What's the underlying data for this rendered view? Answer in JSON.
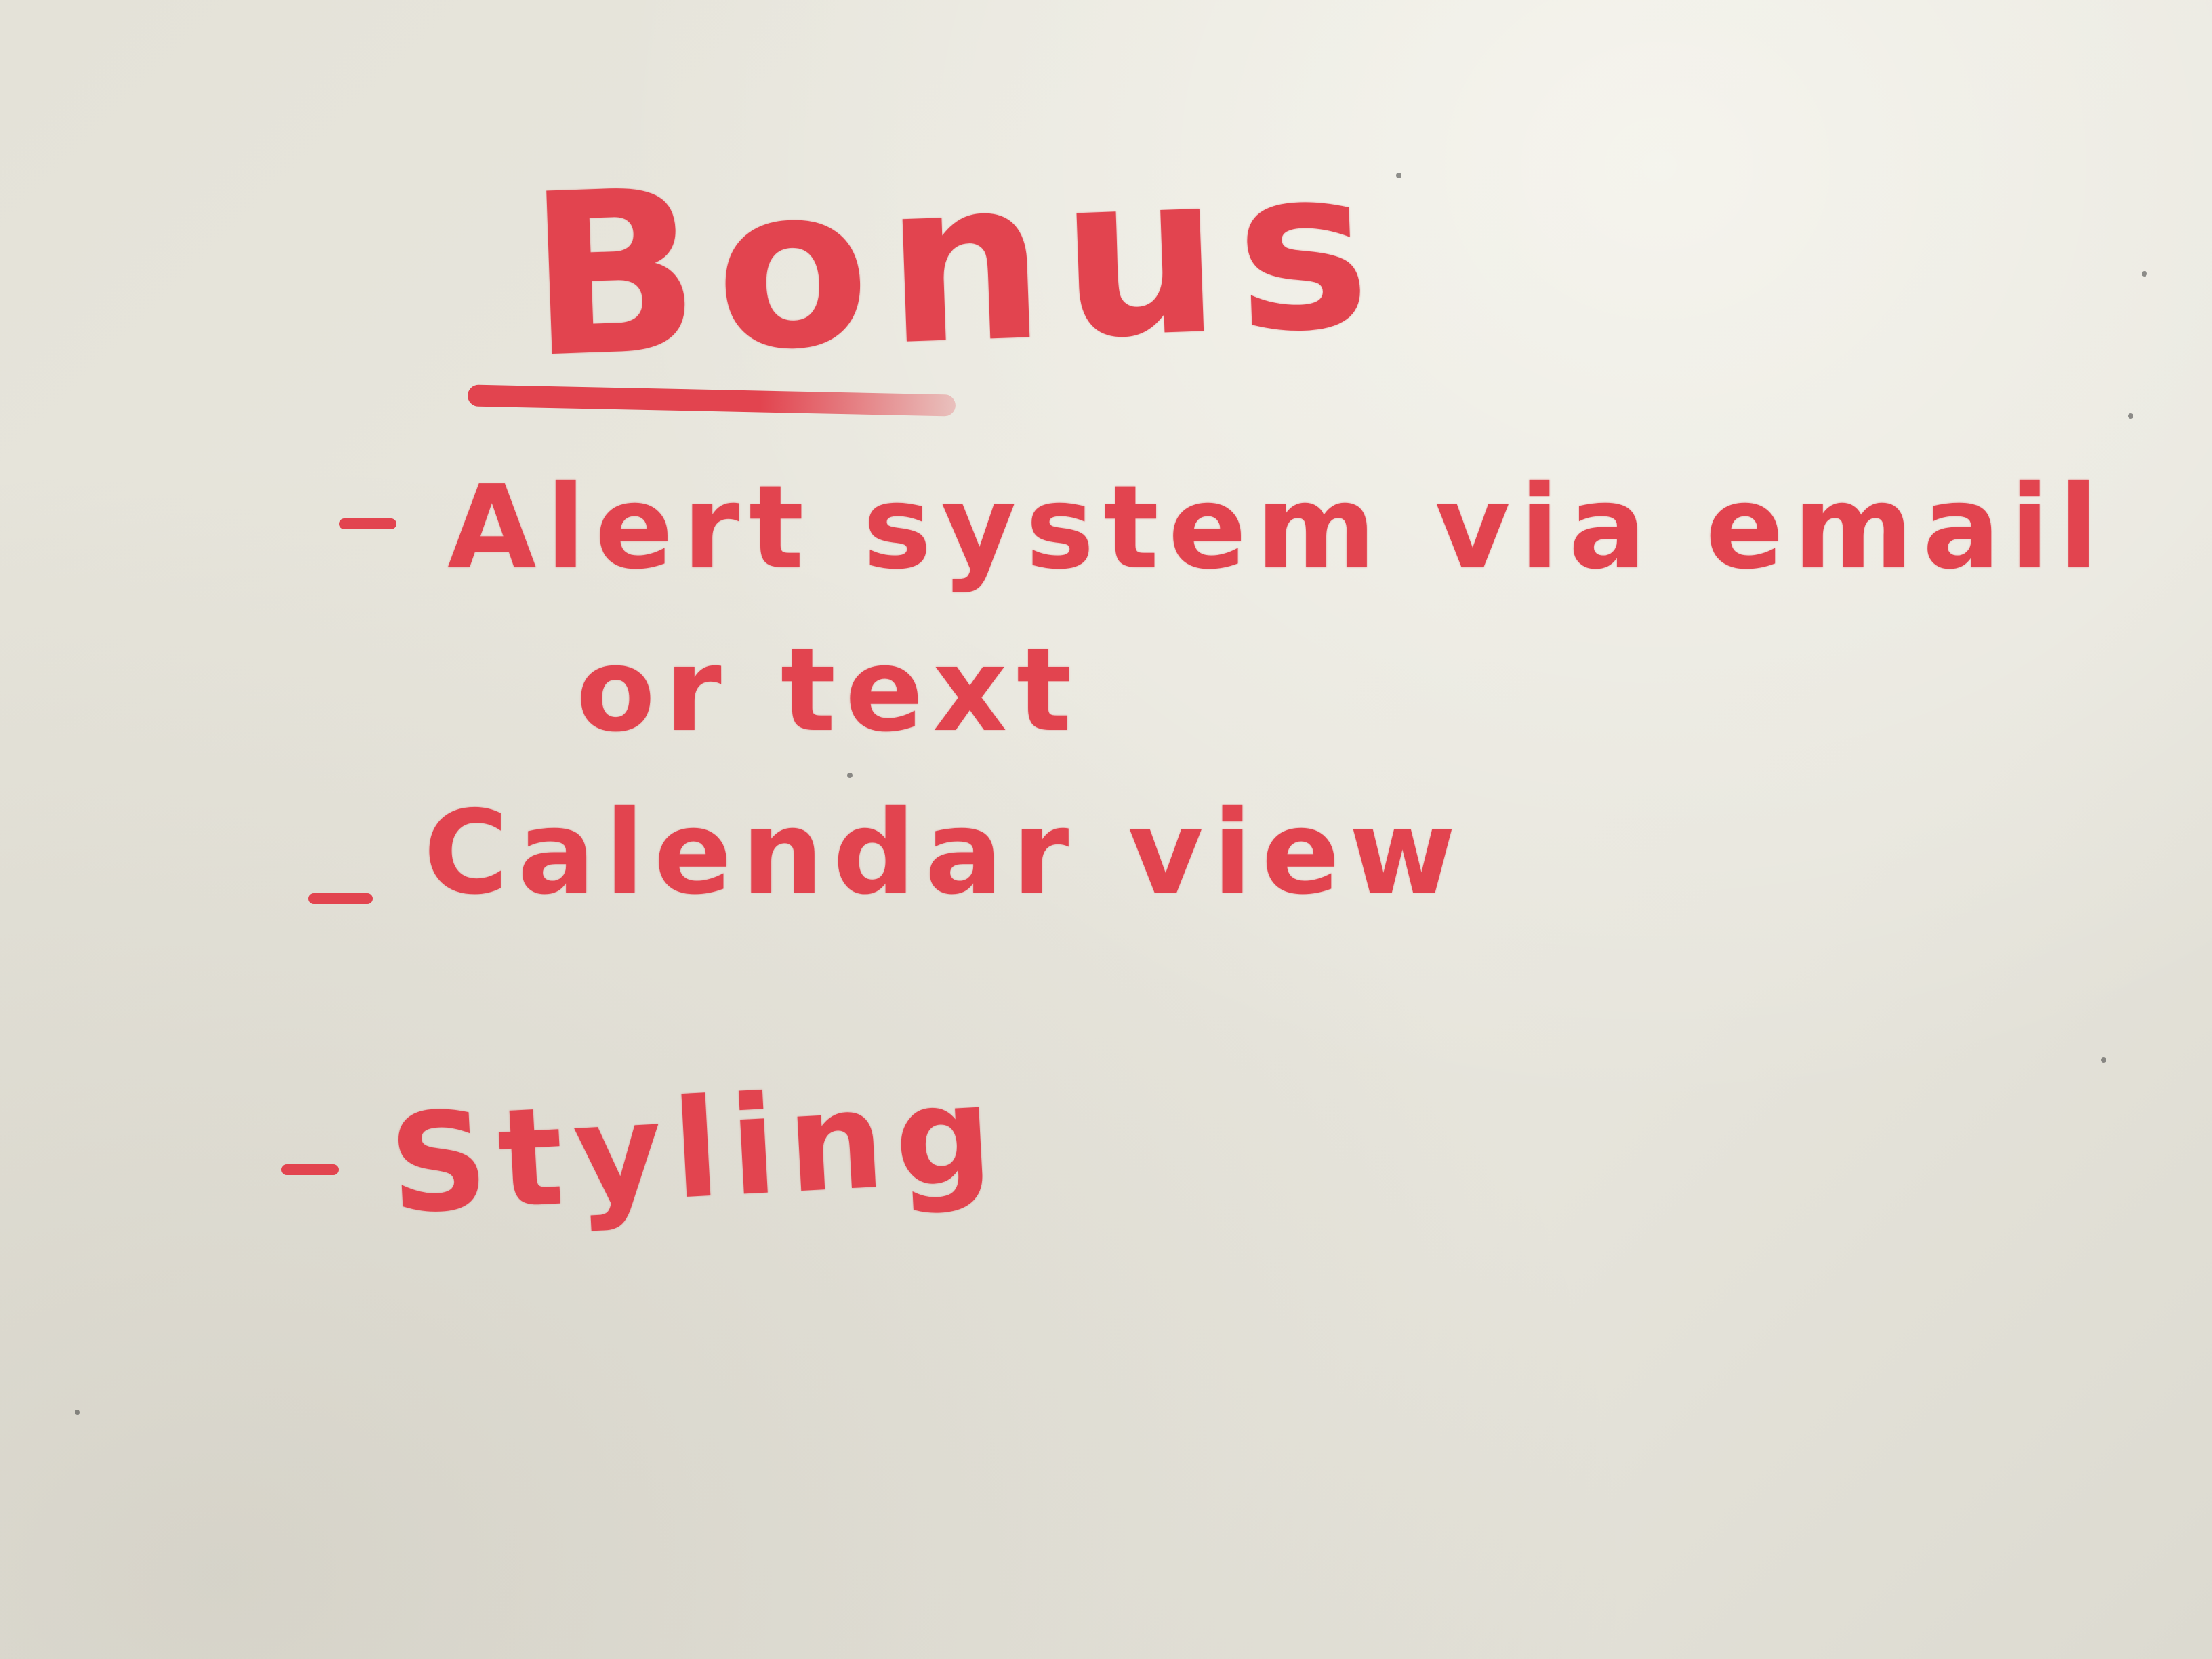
{
  "whiteboard": {
    "title": "Bonus",
    "items": [
      {
        "line1": "Alert system via email",
        "line2": "or text"
      },
      {
        "line1": "Calendar view"
      },
      {
        "line1": "Styling"
      }
    ]
  },
  "colors": {
    "marker": "#e2444f",
    "board": "#e6e4db"
  }
}
